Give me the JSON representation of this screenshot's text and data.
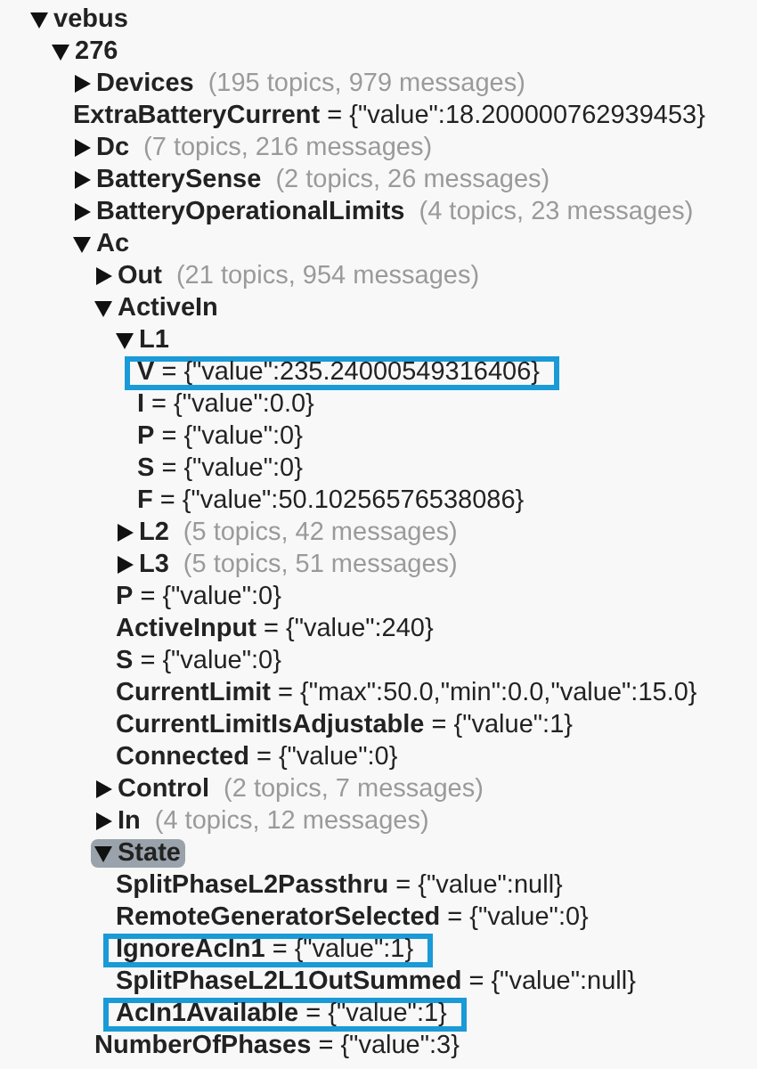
{
  "tree": [
    {
      "kind": "node",
      "label": "vebus",
      "expanded": true,
      "selected": false,
      "children": [
        {
          "kind": "node",
          "label": "276",
          "expanded": true,
          "selected": false,
          "children": [
            {
              "kind": "node",
              "label": "Devices",
              "summary": "(195 topics, 979 messages)",
              "expanded": false,
              "selected": false
            },
            {
              "kind": "leaf",
              "text": "**ExtraBatteryCurrent** = {\"value\":18.200000762939453}",
              "highlighted": false
            },
            {
              "kind": "node",
              "label": "Dc",
              "summary": "(7 topics, 216 messages)",
              "expanded": false,
              "selected": false
            },
            {
              "kind": "node",
              "label": "BatterySense",
              "summary": "(2 topics, 26 messages)",
              "expanded": false,
              "selected": false
            },
            {
              "kind": "node",
              "label": "BatteryOperationalLimits",
              "summary": "(4 topics, 23 messages)",
              "expanded": false,
              "selected": false
            },
            {
              "kind": "node",
              "label": "Ac",
              "expanded": true,
              "selected": false,
              "children": [
                {
                  "kind": "node",
                  "label": "Out",
                  "summary": "(21 topics, 954 messages)",
                  "expanded": false,
                  "selected": false
                },
                {
                  "kind": "node",
                  "label": "ActiveIn",
                  "expanded": true,
                  "selected": false,
                  "children": [
                    {
                      "kind": "node",
                      "label": "L1",
                      "expanded": true,
                      "selected": false,
                      "children": [
                        {
                          "kind": "leaf",
                          "text": "**V** = {\"value\":235.24000549316406}",
                          "highlighted": true
                        },
                        {
                          "kind": "leaf",
                          "text": "**I** = {\"value\":0.0}",
                          "highlighted": false
                        },
                        {
                          "kind": "leaf",
                          "text": "**P** = {\"value\":0}",
                          "highlighted": false
                        },
                        {
                          "kind": "leaf",
                          "text": "**S** = {\"value\":0}",
                          "highlighted": false
                        },
                        {
                          "kind": "leaf",
                          "text": "**F** = {\"value\":50.10256576538086}",
                          "highlighted": false
                        }
                      ]
                    },
                    {
                      "kind": "node",
                      "label": "L2",
                      "summary": "(5 topics, 42 messages)",
                      "expanded": false,
                      "selected": false
                    },
                    {
                      "kind": "node",
                      "label": "L3",
                      "summary": "(5 topics, 51 messages)",
                      "expanded": false,
                      "selected": false
                    },
                    {
                      "kind": "leaf",
                      "text": "**P** = {\"value\":0}",
                      "highlighted": false
                    },
                    {
                      "kind": "leaf",
                      "text": "**ActiveInput** = {\"value\":240}",
                      "highlighted": false
                    },
                    {
                      "kind": "leaf",
                      "text": "**S** = {\"value\":0}",
                      "highlighted": false
                    },
                    {
                      "kind": "leaf",
                      "text": "**CurrentLimit** = {\"max\":50.0,\"min\":0.0,\"value\":15.0}",
                      "highlighted": false
                    },
                    {
                      "kind": "leaf",
                      "text": "**CurrentLimitIsAdjustable** = {\"value\":1}",
                      "highlighted": false
                    },
                    {
                      "kind": "leaf",
                      "text": "**Connected** = {\"value\":0}",
                      "highlighted": false
                    }
                  ]
                },
                {
                  "kind": "node",
                  "label": "Control",
                  "summary": "(2 topics, 7 messages)",
                  "expanded": false,
                  "selected": false
                },
                {
                  "kind": "node",
                  "label": "In",
                  "summary": "(4 topics, 12 messages)",
                  "expanded": false,
                  "selected": false
                },
                {
                  "kind": "node",
                  "label": "State",
                  "expanded": true,
                  "selected": true,
                  "children": [
                    {
                      "kind": "leaf",
                      "text": "**SplitPhaseL2Passthru** = {\"value\":null}",
                      "highlighted": false
                    },
                    {
                      "kind": "leaf",
                      "text": "**RemoteGeneratorSelected** = {\"value\":0}",
                      "highlighted": false
                    },
                    {
                      "kind": "leaf",
                      "text": "**IgnoreAcIn1** = {\"value\":1}",
                      "highlighted": true
                    },
                    {
                      "kind": "leaf",
                      "text": "**SplitPhaseL2L1OutSummed** = {\"value\":null}",
                      "highlighted": false
                    },
                    {
                      "kind": "leaf",
                      "text": "**AcIn1Available** = {\"value\":1}",
                      "highlighted": true
                    }
                  ]
                },
                {
                  "kind": "leaf",
                  "text": "**NumberOfPhases** = {\"value\":3}",
                  "highlighted": false
                }
              ]
            }
          ]
        }
      ]
    }
  ]
}
